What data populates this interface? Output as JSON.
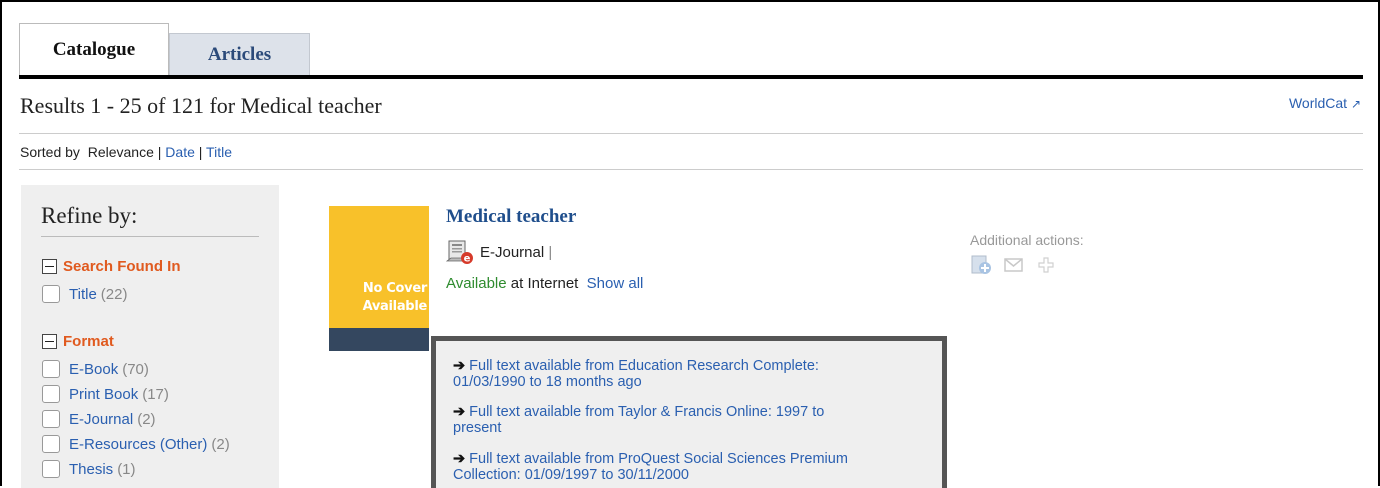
{
  "tabs": {
    "catalogue": "Catalogue",
    "articles": "Articles"
  },
  "results_title": "Results 1 - 25 of 121 for Medical teacher",
  "worldcat": {
    "label": "WorldCat",
    "icon": "external-link-icon"
  },
  "sort": {
    "prefix": "Sorted by",
    "current": "Relevance",
    "sep": "|",
    "date": "Date",
    "title": "Title"
  },
  "sidebar": {
    "title": "Refine by:",
    "search_found_in": {
      "label": "Search Found In",
      "items": [
        {
          "label": "Title",
          "count": "(22)"
        }
      ]
    },
    "format": {
      "label": "Format",
      "items": [
        {
          "label": "E-Book",
          "count": "(70)"
        },
        {
          "label": "Print Book",
          "count": "(17)"
        },
        {
          "label": "E-Journal",
          "count": "(2)"
        },
        {
          "label": "E-Resources (Other)",
          "count": "(2)"
        },
        {
          "label": "Thesis",
          "count": "(1)"
        }
      ]
    }
  },
  "record": {
    "cover_line1": "No Cover",
    "cover_line2": "Available",
    "title": "Medical teacher",
    "format": "E-Journal",
    "format_sep": "|",
    "available": "Available",
    "at": "at Internet",
    "show_all": "Show all",
    "additional_actions": "Additional actions:"
  },
  "fulltext": [
    {
      "line1": "Full text available from Education Research Complete:",
      "line2": "01/03/1990 to 18 months ago"
    },
    {
      "line1": "Full text available from Taylor & Francis Online: 1997 to",
      "line2": "present"
    },
    {
      "line1": "Full text available from ProQuest Social Sciences Premium",
      "line2": "Collection: 01/09/1997 to 30/11/2000"
    }
  ],
  "colors": {
    "link": "#2a5fb0",
    "facet_heading": "#e05a1f",
    "cover": "#f8c12a",
    "cover_band": "#34475f"
  }
}
